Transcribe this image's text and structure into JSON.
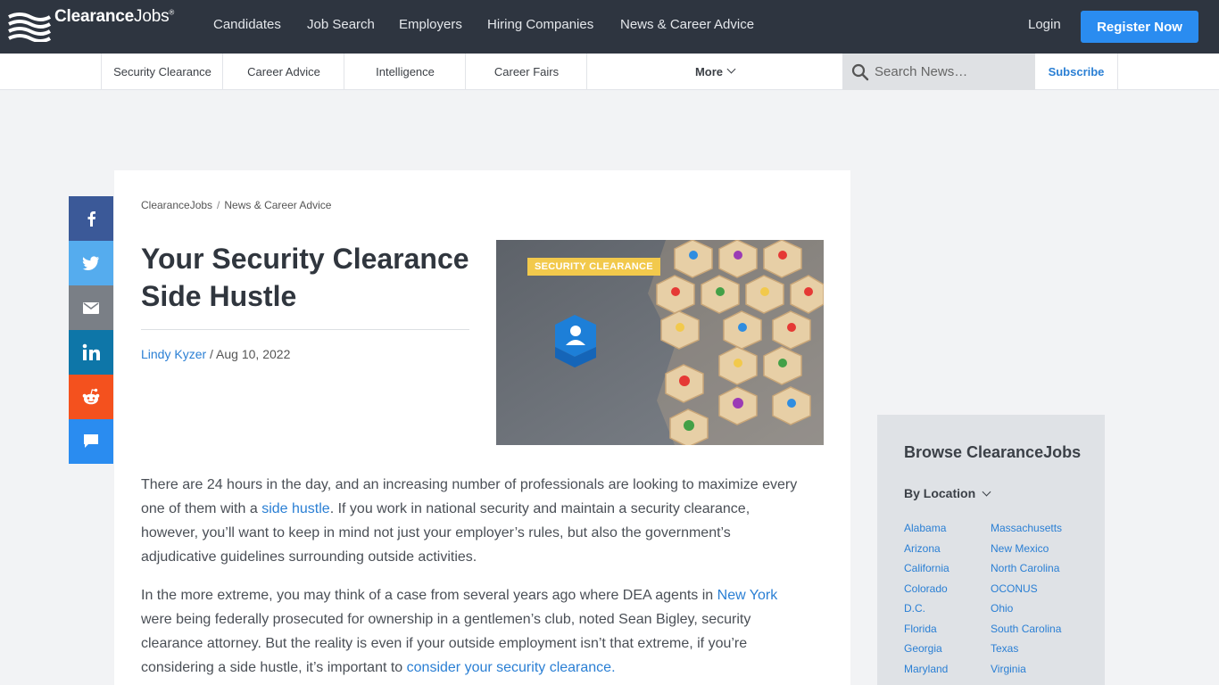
{
  "header": {
    "logo_bold": "Clearance",
    "logo_light": "Jobs",
    "logo_reg": "®",
    "nav": [
      "Candidates",
      "Job Search",
      "Employers",
      "Hiring Companies",
      "News & Career Advice"
    ],
    "login": "Login",
    "register": "Register Now"
  },
  "subnav": {
    "items": [
      "Security Clearance",
      "Career Advice",
      "Intelligence",
      "Career Fairs"
    ],
    "more": "More",
    "search_placeholder": "Search News…",
    "subscribe": "Subscribe"
  },
  "article": {
    "breadcrumb": [
      "ClearanceJobs",
      "News & Career Advice"
    ],
    "breadcrumb_sep": "/",
    "title": "Your Security Clearance Side Hustle",
    "author": "Lindy Kyzer",
    "date": "/ Aug 10, 2022",
    "hero_tag": "SECURITY CLEARANCE",
    "p1": {
      "a": "There are 24 hours in the day, and an increasing number of professionals are looking to maximize every one of them with a ",
      "link": "side hustle",
      "b": ". If you work in national security and maintain a security clearance, however, you’ll want to keep in mind not just your employer’s rules, but also the government’s adjudicative guidelines surrounding outside activities."
    },
    "p2": {
      "a": "In the more extreme, you may think of a case from several years ago where DEA agents in ",
      "link1": "New York",
      "b": " were being federally prosecuted for ownership in a gentlemen’s club, noted Sean Bigley, security clearance attorney. But the reality is even if your outside employment isn’t that extreme, if you’re considering a side hustle, it’s important to ",
      "link2": "consider your security clearance."
    }
  },
  "share": [
    {
      "name": "facebook",
      "color": "#3b5998"
    },
    {
      "name": "twitter",
      "color": "#55acee"
    },
    {
      "name": "email",
      "color": "#7a7f86"
    },
    {
      "name": "linkedin",
      "color": "#0e76a8"
    },
    {
      "name": "reddit",
      "color": "#f4511e"
    },
    {
      "name": "comment",
      "color": "#2a8cf0"
    }
  ],
  "sidebar": {
    "title": "Browse ClearanceJobs",
    "by_location": "By Location",
    "col1": [
      "Alabama",
      "Arizona",
      "California",
      "Colorado",
      "D.C.",
      "Florida",
      "Georgia",
      "Maryland"
    ],
    "col2": [
      "Massachusetts",
      "New Mexico",
      "North Carolina",
      "OCONUS",
      "Ohio",
      "South Carolina",
      "Texas",
      "Virginia"
    ]
  }
}
